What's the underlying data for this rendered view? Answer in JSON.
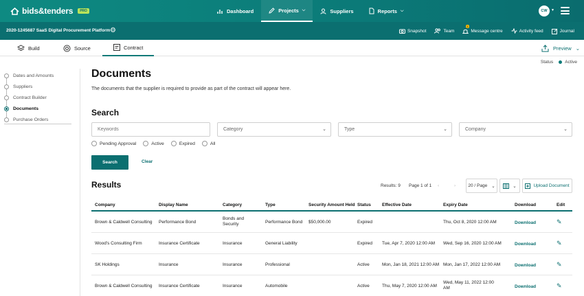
{
  "header": {
    "logo": "bids&tenders",
    "logo_badge": "PRO",
    "nav": [
      {
        "label": "Dashboard",
        "icon": "bar-chart-icon"
      },
      {
        "label": "Projects",
        "icon": "pencil-icon"
      },
      {
        "label": "Suppliers",
        "icon": "user-icon"
      },
      {
        "label": "Reports",
        "icon": "document-icon"
      }
    ],
    "avatar": "CW"
  },
  "subbar": {
    "project": "2020-1245687 SaaS Digital Procurement Platform",
    "tools": [
      {
        "label": "Snapshot",
        "icon": "camera-icon"
      },
      {
        "label": "Team",
        "icon": "people-icon"
      },
      {
        "label": "Message centre",
        "icon": "bell-icon",
        "badge": "1"
      },
      {
        "label": "Activity feed",
        "icon": "activity-icon"
      },
      {
        "label": "Journal",
        "icon": "edit-icon"
      }
    ]
  },
  "tabs": [
    {
      "label": "Build",
      "icon": "layers-icon"
    },
    {
      "label": "Source",
      "icon": "target-icon"
    },
    {
      "label": "Contract",
      "icon": "contract-icon"
    }
  ],
  "preview_label": "Preview",
  "status": {
    "label": "Status",
    "value": "Active",
    "color": "#0b7a78"
  },
  "steps": [
    "Dates and Amounts",
    "Suppliers",
    "Contract Builder",
    "Documents",
    "Purchase Orders"
  ],
  "active_step": "Documents",
  "page": {
    "title": "Documents",
    "description": "The documents that the supplier is required to provide as part of the contract will appear here."
  },
  "search": {
    "title": "Search",
    "keywords_placeholder": "Keywords",
    "category_placeholder": "Category",
    "type_placeholder": "Type",
    "company_placeholder": "Company",
    "radios": [
      "Pending Approval",
      "Active",
      "Expired",
      "All"
    ],
    "search_button": "Search",
    "clear_button": "Clear"
  },
  "results": {
    "title": "Results",
    "count": "Results: 9",
    "page": "Page 1 of 1",
    "per_page": "20 / Page",
    "upload": "Upload Document",
    "columns": [
      "Company",
      "Display Name",
      "Category",
      "Type",
      "Security Amount Held",
      "Status",
      "Effective Date",
      "Expiry Date",
      "Download",
      "Edit"
    ],
    "rows": [
      {
        "company": "Brown & Caldwell Consulting",
        "name": "Performance Bond",
        "category": "Bonds and Security",
        "type": "Performance Bond",
        "amount": "$50,000.00",
        "status": "Expired",
        "effective": "",
        "expiry": "Thu, Oct 8, 2020 12:00 AM",
        "download": "Download"
      },
      {
        "company": "Wood's Consulting Firm",
        "name": "Insurance Certificate",
        "category": "Insurance",
        "type": "General Liability",
        "amount": "",
        "status": "Expired",
        "effective": "Tue, Apr 7, 2020 12:00 AM",
        "expiry": "Wed, Sep 16, 2020 12:00 AM",
        "download": "Download"
      },
      {
        "company": "SK Holdings",
        "name": "Insurance",
        "category": "Insurance",
        "type": "Professional",
        "amount": "",
        "status": "Active",
        "effective": "Mon, Jan 18, 2021 12:00 AM",
        "expiry": "Mon, Jan 17, 2022 12:00 AM",
        "download": "Download"
      },
      {
        "company": "Brown & Caldwell Consulting",
        "name": "Insurance Certificate",
        "category": "Insurance",
        "type": "Automobile",
        "amount": "",
        "status": "Active",
        "effective": "Thu, May 7, 2020 12:00 AM",
        "expiry": "Wed, May 11, 2022 12:00 AM",
        "download": "Download"
      }
    ]
  }
}
